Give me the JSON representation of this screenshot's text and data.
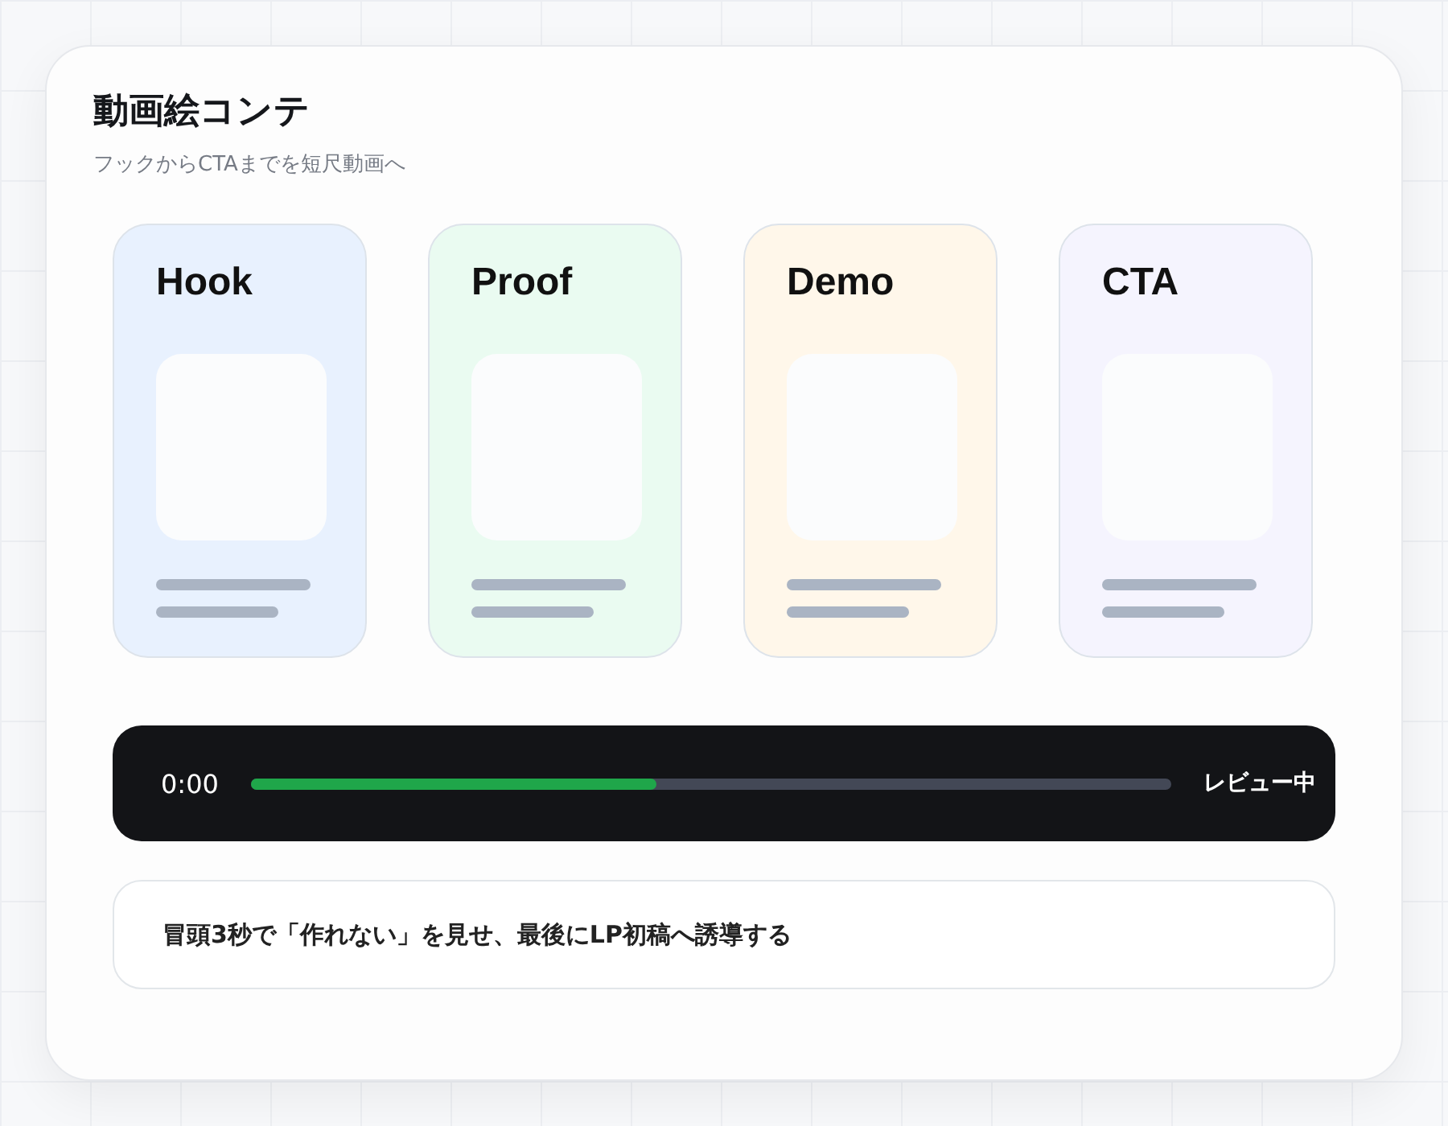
{
  "title": "動画絵コンテ",
  "subtitle": "フックからCTAまでを短尺動画へ",
  "scenes": [
    {
      "label": "Hook",
      "color": "#e8f1fe"
    },
    {
      "label": "Proof",
      "color": "#eafbf1"
    },
    {
      "label": "Demo",
      "color": "#fff7ea"
    },
    {
      "label": "CTA",
      "color": "#f5f4fe"
    }
  ],
  "player": {
    "time": "0:00",
    "level": 0.44,
    "status": "レビュー中"
  },
  "note": "冒頭3秒で「作れない」を見せ、最後にLP初稿へ誘導する"
}
